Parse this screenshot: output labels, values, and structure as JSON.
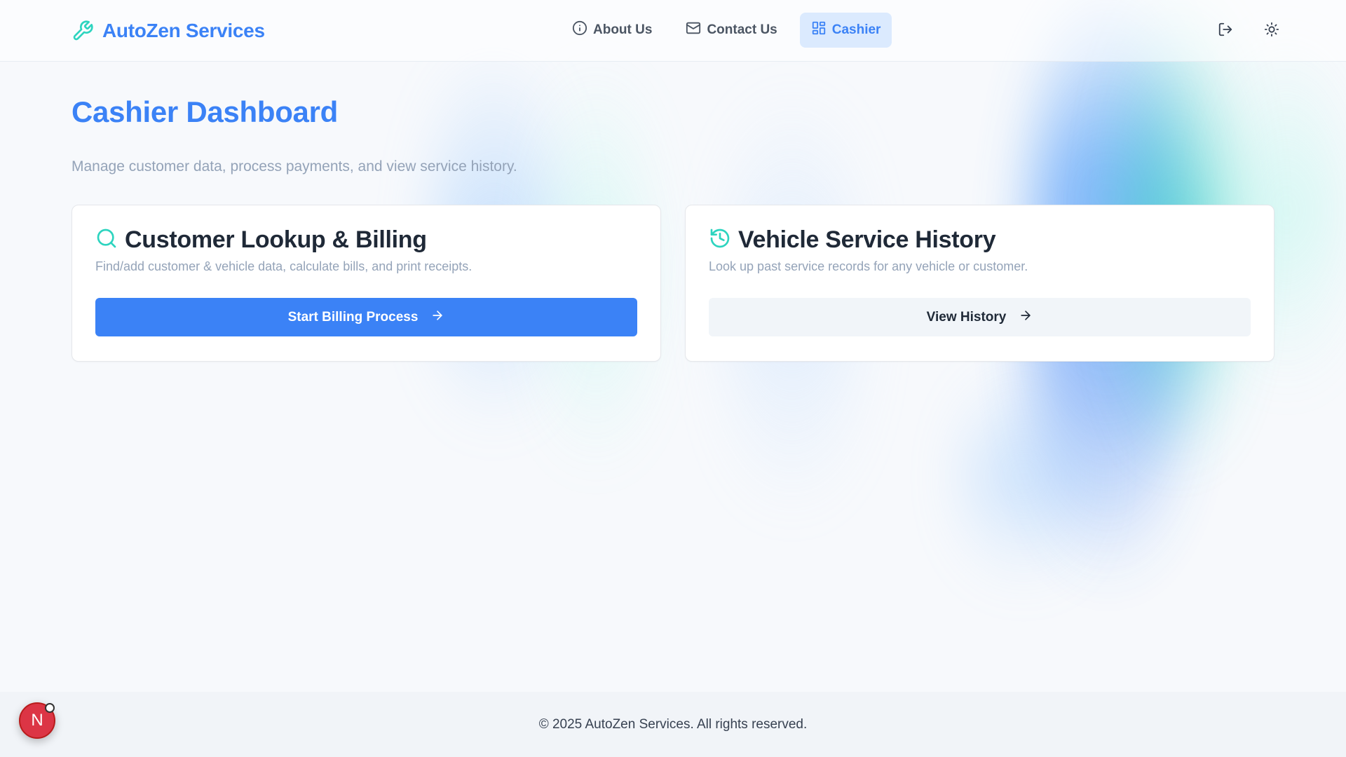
{
  "brand": {
    "name": "AutoZen Services",
    "icon": "wrench-icon"
  },
  "nav": {
    "items": [
      {
        "label": "About Us",
        "icon": "info-icon",
        "active": false
      },
      {
        "label": "Contact Us",
        "icon": "mail-icon",
        "active": false
      },
      {
        "label": "Cashier",
        "icon": "dashboard-grid-icon",
        "active": true
      }
    ]
  },
  "header_actions": [
    {
      "icon": "logout-icon"
    },
    {
      "icon": "sun-icon"
    }
  ],
  "page": {
    "title": "Cashier Dashboard",
    "subtitle": "Manage customer data, process payments, and view service history."
  },
  "cards": [
    {
      "title": "Customer Lookup & Billing",
      "description": "Find/add customer & vehicle data, calculate bills, and print receipts.",
      "icon": "search-icon",
      "button_label": "Start Billing Process"
    },
    {
      "title": "Vehicle Service History",
      "description": "Look up past service records for any vehicle or customer.",
      "icon": "history-icon",
      "button_label": "View History"
    }
  ],
  "footer": {
    "copyright": "© 2025 AutoZen Services. All rights reserved."
  },
  "dev_badge": {
    "letter": "N"
  },
  "colors": {
    "accent": "#3b82f6",
    "teal": "#2dd4bf",
    "active_nav_bg": "#dbeafe",
    "muted_text": "#94a3b8"
  }
}
